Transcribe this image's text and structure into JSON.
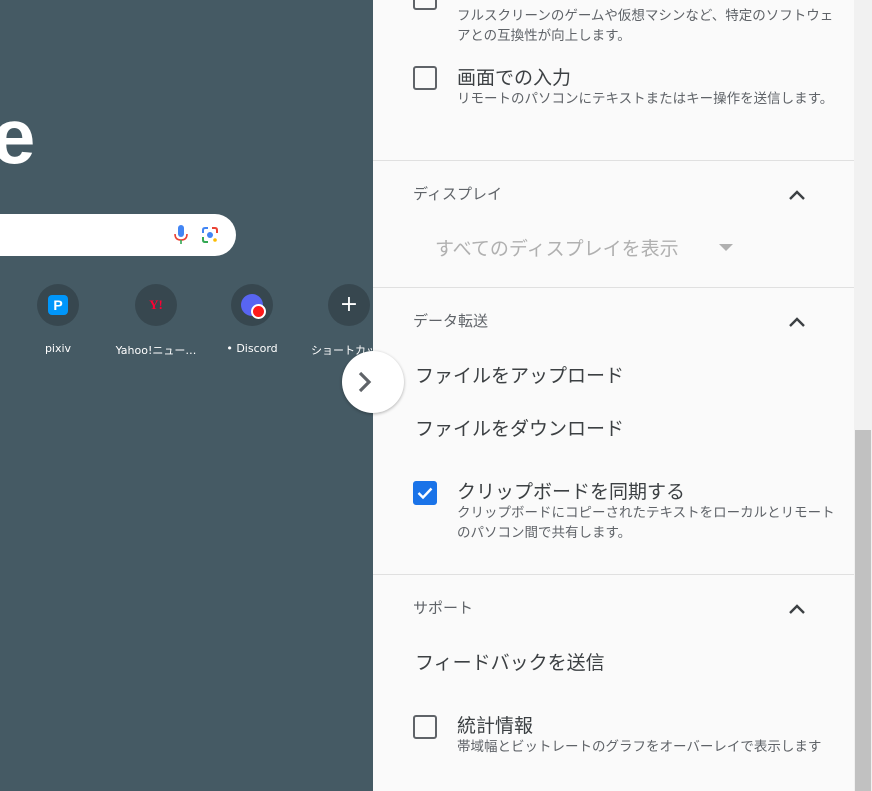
{
  "background": {
    "logo_fragment": "e",
    "shortcuts": [
      {
        "label": "pixiv",
        "icon": "pixiv-icon"
      },
      {
        "label": "Yahoo!ニュー…",
        "icon": "yahoo-icon",
        "glyph": "Y!"
      },
      {
        "label": "• Discord",
        "icon": "discord-icon"
      },
      {
        "label": "ショートカッ",
        "icon": "plus-icon",
        "glyph": "+"
      }
    ]
  },
  "panel": {
    "options_top": [
      {
        "title": "",
        "desc": "フルスクリーンのゲームや仮想マシンなど、特定のソフトウェアとの互換性が向上します。",
        "checked": false
      },
      {
        "title": "画面での入力",
        "desc": "リモートのパソコンにテキストまたはキー操作を送信します。",
        "checked": false
      }
    ],
    "display": {
      "title": "ディスプレイ",
      "select_value": "すべてのディスプレイを表示"
    },
    "transfer": {
      "title": "データ転送",
      "upload": "ファイルをアップロード",
      "download": "ファイルをダウンロード",
      "clipboard_title": "クリップボードを同期する",
      "clipboard_desc": "クリップボードにコピーされたテキストをローカルとリモートのパソコン間で共有します。",
      "clipboard_checked": true
    },
    "support": {
      "title": "サポート",
      "feedback": "フィードバックを送信",
      "stats_title": "統計情報",
      "stats_desc": "帯域幅とビットレートのグラフをオーバーレイで表示します",
      "stats_checked": false
    }
  },
  "colors": {
    "background": "#455a64",
    "panel": "#fafafa",
    "accent": "#1a73e8"
  }
}
